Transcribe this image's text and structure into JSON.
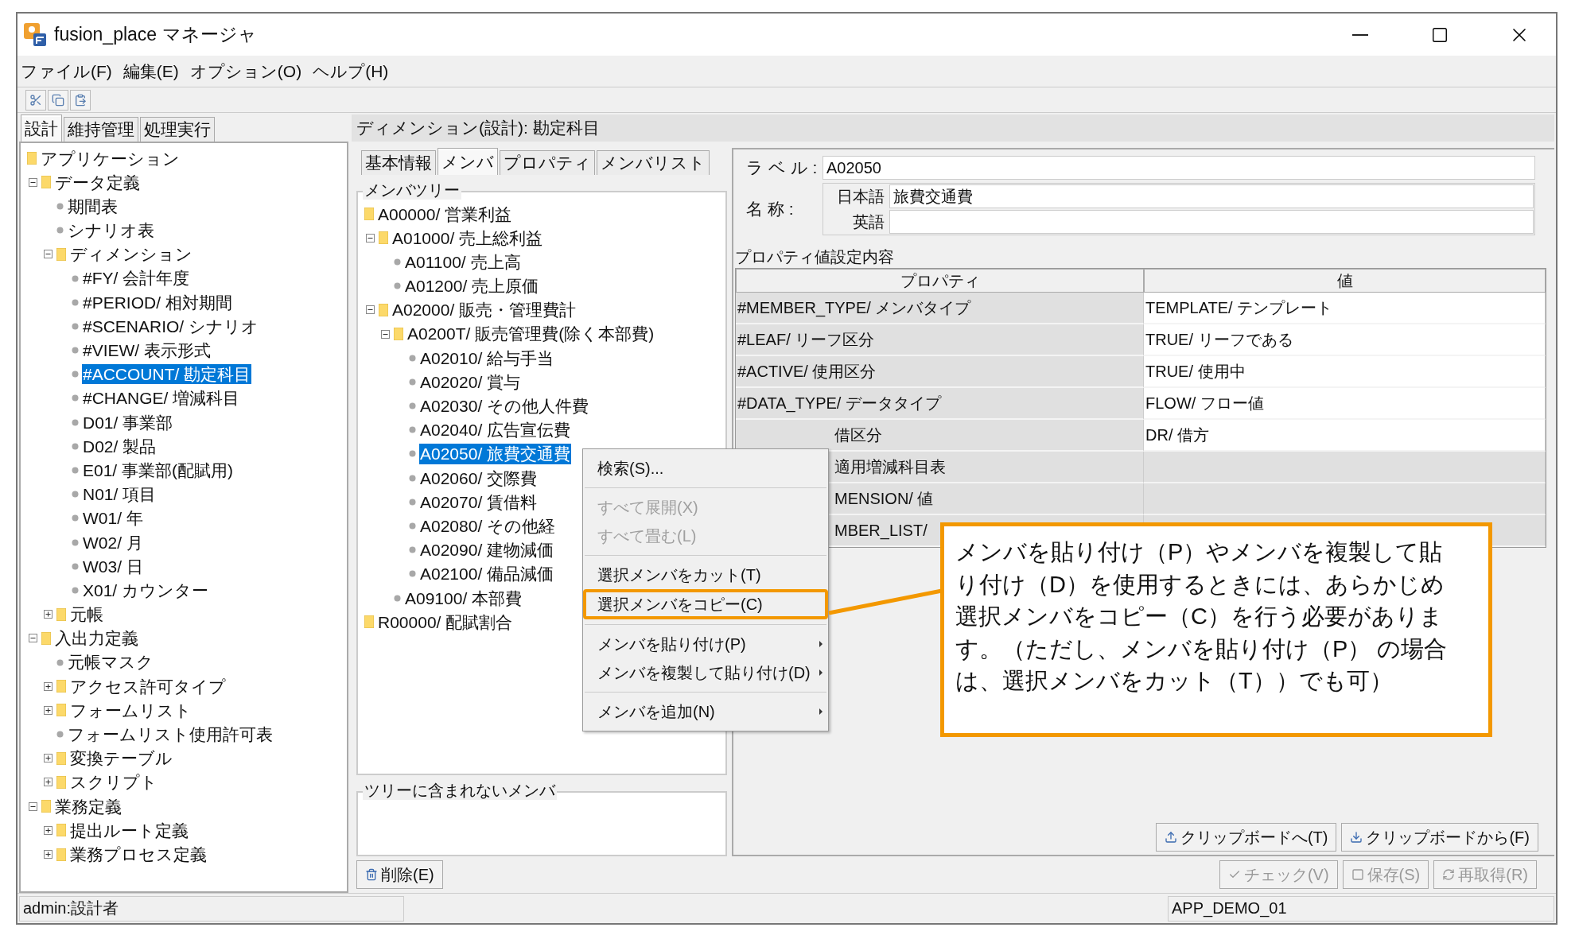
{
  "window": {
    "title": "fusion_place マネージャ"
  },
  "menu_bar": [
    "ファイル(F)",
    "編集(E)",
    "オプション(O)",
    "ヘルプ(H)"
  ],
  "toolbar": [
    {
      "kind": "cut"
    },
    {
      "kind": "copy"
    },
    {
      "kind": "paste"
    }
  ],
  "left_tabs": [
    {
      "label": "設計",
      "selected": true
    },
    {
      "label": "維持管理",
      "selected": false
    },
    {
      "label": "処理実行",
      "selected": false
    }
  ],
  "app_tree": [
    {
      "label": "アプリケーション",
      "kind": "folder",
      "selected": false,
      "children": [
        {
          "label": "データ定義",
          "kind": "folder",
          "expanded": true,
          "selected": false,
          "children": [
            {
              "label": "期間表",
              "kind": "leaf",
              "selected": false
            },
            {
              "label": "シナリオ表",
              "kind": "leaf",
              "selected": false
            },
            {
              "label": "ディメンション",
              "kind": "folder",
              "expanded": true,
              "selected": false,
              "children": [
                {
                  "label": "#FY/ 会計年度",
                  "kind": "leaf",
                  "selected": false
                },
                {
                  "label": "#PERIOD/ 相対期間",
                  "kind": "leaf",
                  "selected": false
                },
                {
                  "label": "#SCENARIO/ シナリオ",
                  "kind": "leaf",
                  "selected": false
                },
                {
                  "label": "#VIEW/ 表示形式",
                  "kind": "leaf",
                  "selected": false
                },
                {
                  "label": "#ACCOUNT/ 勘定科目",
                  "kind": "leaf",
                  "selected": true
                },
                {
                  "label": "#CHANGE/ 増減科目",
                  "kind": "leaf",
                  "selected": false
                },
                {
                  "label": "D01/ 事業部",
                  "kind": "leaf",
                  "selected": false
                },
                {
                  "label": "D02/ 製品",
                  "kind": "leaf",
                  "selected": false
                },
                {
                  "label": "E01/ 事業部(配賦用)",
                  "kind": "leaf",
                  "selected": false
                },
                {
                  "label": "N01/ 項目",
                  "kind": "leaf",
                  "selected": false
                },
                {
                  "label": "W01/ 年",
                  "kind": "leaf",
                  "selected": false
                },
                {
                  "label": "W02/ 月",
                  "kind": "leaf",
                  "selected": false
                },
                {
                  "label": "W03/ 日",
                  "kind": "leaf",
                  "selected": false
                },
                {
                  "label": "X01/ カウンター",
                  "kind": "leaf",
                  "selected": false
                }
              ]
            },
            {
              "label": "元帳",
              "kind": "folder",
              "expanded": false,
              "selected": false
            }
          ]
        },
        {
          "label": "入出力定義",
          "kind": "folder",
          "expanded": true,
          "selected": false,
          "children": [
            {
              "label": "元帳マスク",
              "kind": "leaf",
              "selected": false
            },
            {
              "label": "アクセス許可タイプ",
              "kind": "folder",
              "expanded": false,
              "selected": false
            },
            {
              "label": "フォームリスト",
              "kind": "folder",
              "expanded": false,
              "selected": false
            },
            {
              "label": "フォームリスト使用許可表",
              "kind": "leaf",
              "selected": false
            },
            {
              "label": "変換テーブル",
              "kind": "folder",
              "expanded": false,
              "selected": false
            },
            {
              "label": "スクリプト",
              "kind": "folder",
              "expanded": false,
              "selected": false
            }
          ]
        },
        {
          "label": "業務定義",
          "kind": "folder",
          "expanded": true,
          "selected": false,
          "children": [
            {
              "label": "提出ルート定義",
              "kind": "folder",
              "expanded": false,
              "selected": false
            },
            {
              "label": "業務プロセス定義",
              "kind": "folder",
              "expanded": false,
              "selected": false
            }
          ]
        }
      ]
    }
  ],
  "panel_title": "ディメンション(設計): 勘定科目",
  "sub_tabs": [
    {
      "label": "基本情報",
      "selected": false
    },
    {
      "label": "メンバ",
      "selected": true
    },
    {
      "label": "プロパティ",
      "selected": false
    },
    {
      "label": "メンバリスト",
      "selected": false
    }
  ],
  "member_tree": {
    "title": "メンバツリー",
    "items": [
      {
        "label": "A00000/ 営業利益",
        "kind": "folder",
        "selected": false,
        "children": [
          {
            "label": "A01000/ 売上総利益",
            "kind": "folder",
            "expanded": true,
            "selected": false,
            "children": [
              {
                "label": "A01100/ 売上高",
                "kind": "leaf",
                "selected": false
              },
              {
                "label": "A01200/ 売上原価",
                "kind": "leaf",
                "selected": false
              }
            ]
          },
          {
            "label": "A02000/ 販売・管理費計",
            "kind": "folder",
            "expanded": true,
            "selected": false,
            "children": [
              {
                "label": "A0200T/ 販売管理費(除く本部費)",
                "kind": "folder",
                "expanded": true,
                "selected": false,
                "children": [
                  {
                    "label": "A02010/ 給与手当",
                    "kind": "leaf",
                    "selected": false
                  },
                  {
                    "label": "A02020/ 賞与",
                    "kind": "leaf",
                    "selected": false
                  },
                  {
                    "label": "A02030/ その他人件費",
                    "kind": "leaf",
                    "selected": false
                  },
                  {
                    "label": "A02040/ 広告宣伝費",
                    "kind": "leaf",
                    "selected": false
                  },
                  {
                    "label": "A02050/ 旅費交通費",
                    "kind": "leaf",
                    "selected": true
                  },
                  {
                    "label": "A02060/ 交際費",
                    "kind": "leaf",
                    "selected": false
                  },
                  {
                    "label": "A02070/ 賃借料",
                    "kind": "leaf",
                    "selected": false
                  },
                  {
                    "label": "A02080/ その他経",
                    "kind": "leaf",
                    "selected": false
                  },
                  {
                    "label": "A02090/ 建物減価",
                    "kind": "leaf",
                    "selected": false
                  },
                  {
                    "label": "A02100/ 備品減価",
                    "kind": "leaf",
                    "selected": false
                  }
                ]
              },
              {
                "label": "A09100/ 本部費",
                "kind": "leaf",
                "selected": false
              }
            ]
          }
        ]
      },
      {
        "label": "R00000/ 配賦割合",
        "kind": "folder",
        "selected": false
      }
    ]
  },
  "excluded_members": {
    "title": "ツリーに含まれないメンバ"
  },
  "form": {
    "label_caption": "ラ ベ ル :",
    "label_value": "A02050",
    "name_caption": "名 称 :",
    "names": [
      {
        "language": "日本語",
        "value": "旅費交通費"
      },
      {
        "language": "英語"
      }
    ]
  },
  "properties": {
    "title": "プロパティ値設定内容",
    "columns": [
      "プロパティ",
      "値"
    ],
    "rows": [
      {
        "property": "#MEMBER_TYPE/ メンバタイプ",
        "value": "TEMPLATE/ テンプレート",
        "kind": "full",
        "editable": true
      },
      {
        "property": "#LEAF/ リーフ区分",
        "value": "TRUE/ リーフである",
        "kind": "full",
        "editable": true
      },
      {
        "property": "#ACTIVE/ 使用区分",
        "value": "TRUE/ 使用中",
        "kind": "full",
        "editable": true
      },
      {
        "property": "#DATA_TYPE/ データタイプ",
        "value": "FLOW/ フロー値",
        "kind": "full",
        "editable": true
      },
      {
        "property": "借区分",
        "value": "DR/ 借方",
        "kind": "partial",
        "editable": true
      },
      {
        "property": "適用増減科目表",
        "kind": "partial",
        "editable": false
      },
      {
        "property": "MENSION/ 値",
        "kind": "partial",
        "editable": false
      },
      {
        "property": "MBER_LIST/",
        "kind": "partial",
        "editable": false
      }
    ]
  },
  "clipboard_buttons": [
    {
      "label": "クリップボードへ(T)",
      "kind": "export"
    },
    {
      "label": "クリップボードから(F)",
      "kind": "import"
    }
  ],
  "delete_button": "削除(E)",
  "action_buttons": [
    {
      "label": "チェック(V)",
      "kind": "check",
      "disabled": true
    },
    {
      "label": "保存(S)",
      "kind": "save",
      "disabled": true
    },
    {
      "label": "再取得(R)",
      "kind": "refetch",
      "disabled": true
    }
  ],
  "context_menu": {
    "groups": [
      [
        {
          "label": "検索(S)...",
          "disabled": false,
          "submenu": false,
          "highlighted": false
        }
      ],
      [
        {
          "label": "すべて展開(X)",
          "disabled": true,
          "submenu": false,
          "highlighted": false
        },
        {
          "label": "すべて畳む(L)",
          "disabled": true,
          "submenu": false,
          "highlighted": false
        }
      ],
      [
        {
          "label": "選択メンバをカット(T)",
          "disabled": false,
          "submenu": false,
          "highlighted": false
        },
        {
          "label": "選択メンバをコピー(C)",
          "disabled": false,
          "submenu": false,
          "highlighted": true
        }
      ],
      [
        {
          "label": "メンバを貼り付け(P)",
          "disabled": false,
          "submenu": true,
          "highlighted": false
        },
        {
          "label": "メンバを複製して貼り付け(D)",
          "disabled": false,
          "submenu": true,
          "highlighted": false
        }
      ],
      [
        {
          "label": "メンバを追加(N)",
          "disabled": false,
          "submenu": true,
          "highlighted": false
        }
      ]
    ]
  },
  "callout": {
    "text": "メンバを貼り付け（P）やメンバを複製して貼り付け（D）を使用するときには、あらかじめ選択メンバをコピー（C）を行う必要があります。（ただし、メンバを貼り付け（P） の場合は、選択メンバをカット（T））でも可）"
  },
  "status_bar": {
    "user": "admin:設計者",
    "application": "APP_DEMO_01"
  }
}
